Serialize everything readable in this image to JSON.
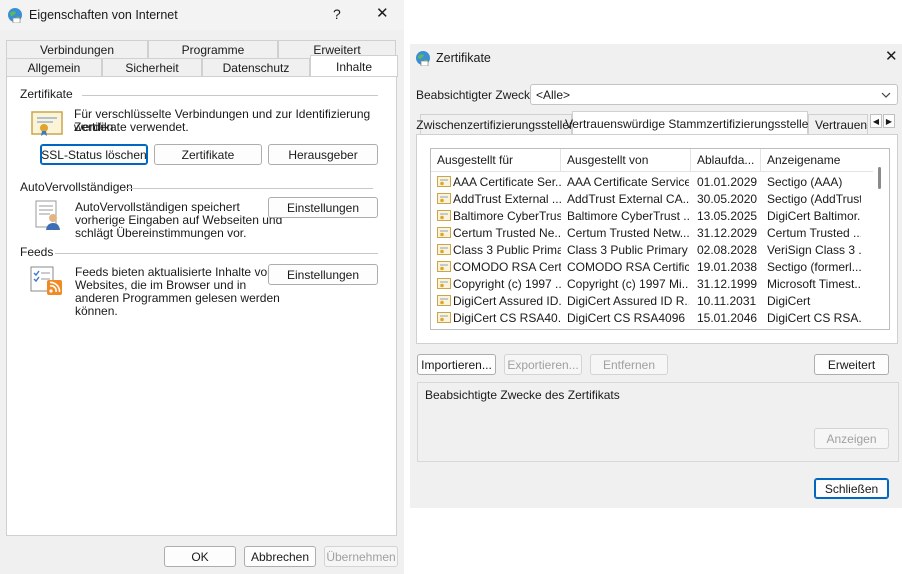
{
  "left_dialog": {
    "title": "Eigenschaften von Internet",
    "help_label": "?",
    "close_label": "✕",
    "tabs_row1": [
      "Verbindungen",
      "Programme",
      "Erweitert"
    ],
    "tabs_row2": [
      "Allgemein",
      "Sicherheit",
      "Datenschutz",
      "Inhalte"
    ],
    "certificates": {
      "heading": "Zertifikate",
      "description_line1": "Für verschlüsselte Verbindungen und zur Identifizierung werden",
      "description_line2": "Zertifikate verwendet.",
      "btn_ssl": "SSL-Status löschen",
      "btn_certs": "Zertifikate",
      "btn_publisher": "Herausgeber"
    },
    "autocomplete": {
      "heading": "AutoVervollständigen",
      "line1": "AutoVervollständigen speichert",
      "line2": "vorherige Eingaben auf Webseiten und",
      "line3": "schlägt Übereinstimmungen vor.",
      "btn_settings": "Einstellungen"
    },
    "feeds": {
      "heading": "Feeds",
      "line1": "Feeds bieten aktualisierte Inhalte von",
      "line2": "Websites, die im Browser und in",
      "line3": "anderen Programmen gelesen werden",
      "line4": "können.",
      "btn_settings": "Einstellungen"
    },
    "footer": {
      "ok": "OK",
      "cancel": "Abbrechen",
      "apply": "Übernehmen"
    }
  },
  "right_dialog": {
    "title": "Zertifikate",
    "close_label": "✕",
    "purpose_label": "Beabsichtigter Zweck:",
    "purpose_value": "<Alle>",
    "tabs": [
      "Zwischenzertifizierungsstellen",
      "Vertrauenswürdige Stammzertifizierungsstellen",
      "Vertrauens"
    ],
    "columns": [
      "Ausgestellt für",
      "Ausgestellt von",
      "Ablaufda...",
      "Anzeigename"
    ],
    "rows": [
      [
        "AAA Certificate Ser...",
        "AAA Certificate Services",
        "01.01.2029",
        "Sectigo (AAA)"
      ],
      [
        "AddTrust External ...",
        "AddTrust External CA...",
        "30.05.2020",
        "Sectigo (AddTrust)"
      ],
      [
        "Baltimore CyberTrust...",
        "Baltimore CyberTrust ...",
        "13.05.2025",
        "DigiCert Baltimor..."
      ],
      [
        "Certum Trusted Ne...",
        "Certum Trusted Netw...",
        "31.12.2029",
        "Certum Trusted ..."
      ],
      [
        "Class 3 Public Prima...",
        "Class 3 Public Primary ...",
        "02.08.2028",
        "VeriSign Class 3 ..."
      ],
      [
        "COMODO RSA Cert...",
        "COMODO RSA Certific...",
        "19.01.2038",
        "Sectigo (formerl..."
      ],
      [
        "Copyright (c) 1997 ...",
        "Copyright (c) 1997 Mi...",
        "31.12.1999",
        "Microsoft Timest..."
      ],
      [
        "DigiCert Assured ID...",
        "DigiCert Assured ID R...",
        "10.11.2031",
        "DigiCert"
      ],
      [
        "DigiCert CS RSA40...",
        "DigiCert CS RSA4096 ...",
        "15.01.2046",
        "DigiCert CS RSA..."
      ]
    ],
    "btn_import": "Importieren...",
    "btn_export": "Exportieren...",
    "btn_remove": "Entfernen",
    "btn_advanced": "Erweitert",
    "purposes_group_label": "Beabsichtigte Zwecke des Zertifikats",
    "btn_view": "Anzeigen",
    "btn_close": "Schließen"
  }
}
